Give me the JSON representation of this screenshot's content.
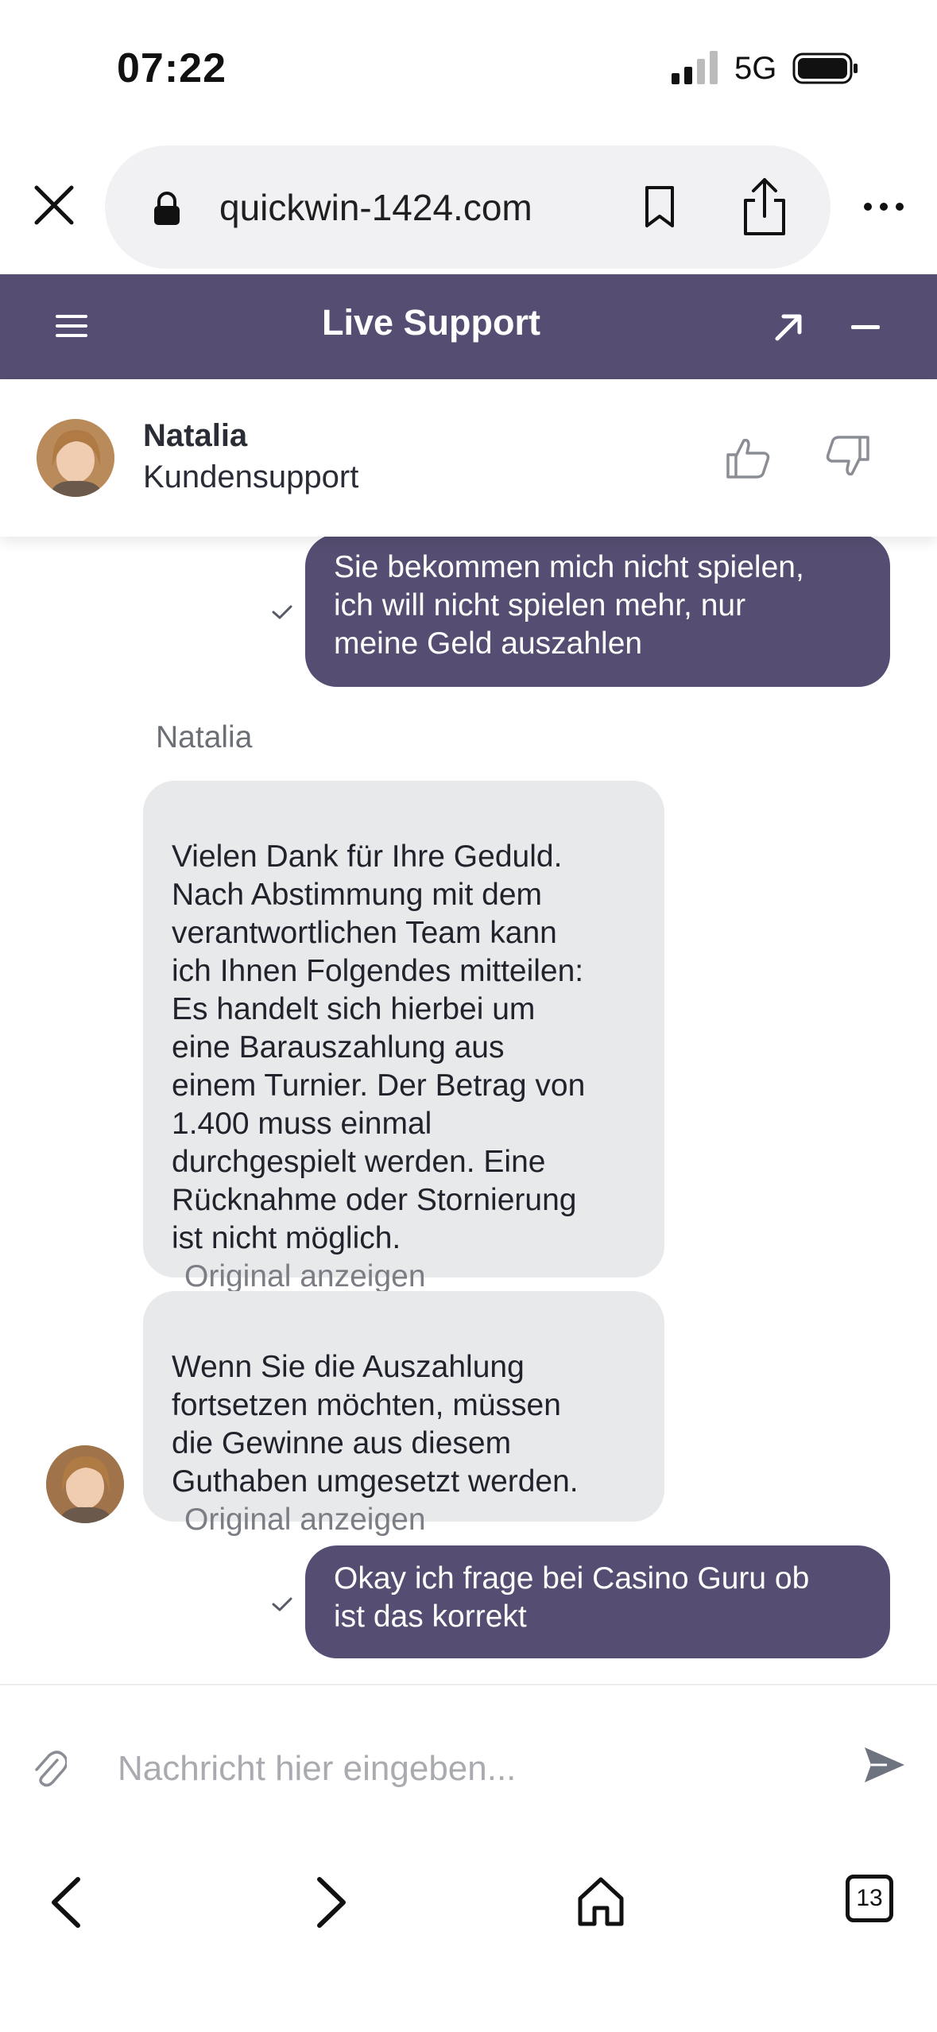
{
  "status_bar": {
    "time": "07:22",
    "network": "5G"
  },
  "browser": {
    "url": "quickwin-1424.com",
    "tab_count": "13"
  },
  "header": {
    "title": "Live Support"
  },
  "agent": {
    "name": "Natalia",
    "role": "Kundensupport"
  },
  "messages": [
    {
      "from": "user",
      "text": "Sie bekommen mich nicht spielen,\nich will nicht spielen mehr, nur\nmeine Geld auszahlen",
      "status": "sent"
    },
    {
      "from": "agent",
      "sender": "Natalia",
      "text": "Vielen Dank für Ihre Geduld.\nNach Abstimmung mit dem\nverantwortlichen Team kann\nich Ihnen Folgendes mitteilen:\nEs handelt sich hierbei um\neine Barauszahlung aus\neinem Turnier. Der Betrag von\n1.400 muss einmal\ndurchgespielt werden. Eine\nRücknahme oder Stornierung\nist nicht möglich.",
      "link": "Original anzeigen"
    },
    {
      "from": "agent",
      "text": "Wenn Sie die Auszahlung\nfortsetzen möchten, müssen\ndie Gewinne aus diesem\nGuthaben umgesetzt werden.",
      "link": "Original anzeigen"
    },
    {
      "from": "user",
      "text": "Okay ich frage bei Casino Guru ob\nist das korrekt",
      "status": "sent"
    }
  ],
  "composer": {
    "placeholder": "Nachricht hier eingeben..."
  },
  "colors": {
    "brand": "#554e72",
    "agent_bubble": "#e8e9eb"
  },
  "icons": [
    "close-icon",
    "lock-icon",
    "bookmark-icon",
    "share-icon",
    "more-icon",
    "menu-icon",
    "expand-icon",
    "minimize-icon",
    "thumbs-up-icon",
    "thumbs-down-icon",
    "check-icon",
    "paperclip-icon",
    "send-icon",
    "back-icon",
    "forward-icon",
    "home-icon",
    "tabs-icon"
  ]
}
